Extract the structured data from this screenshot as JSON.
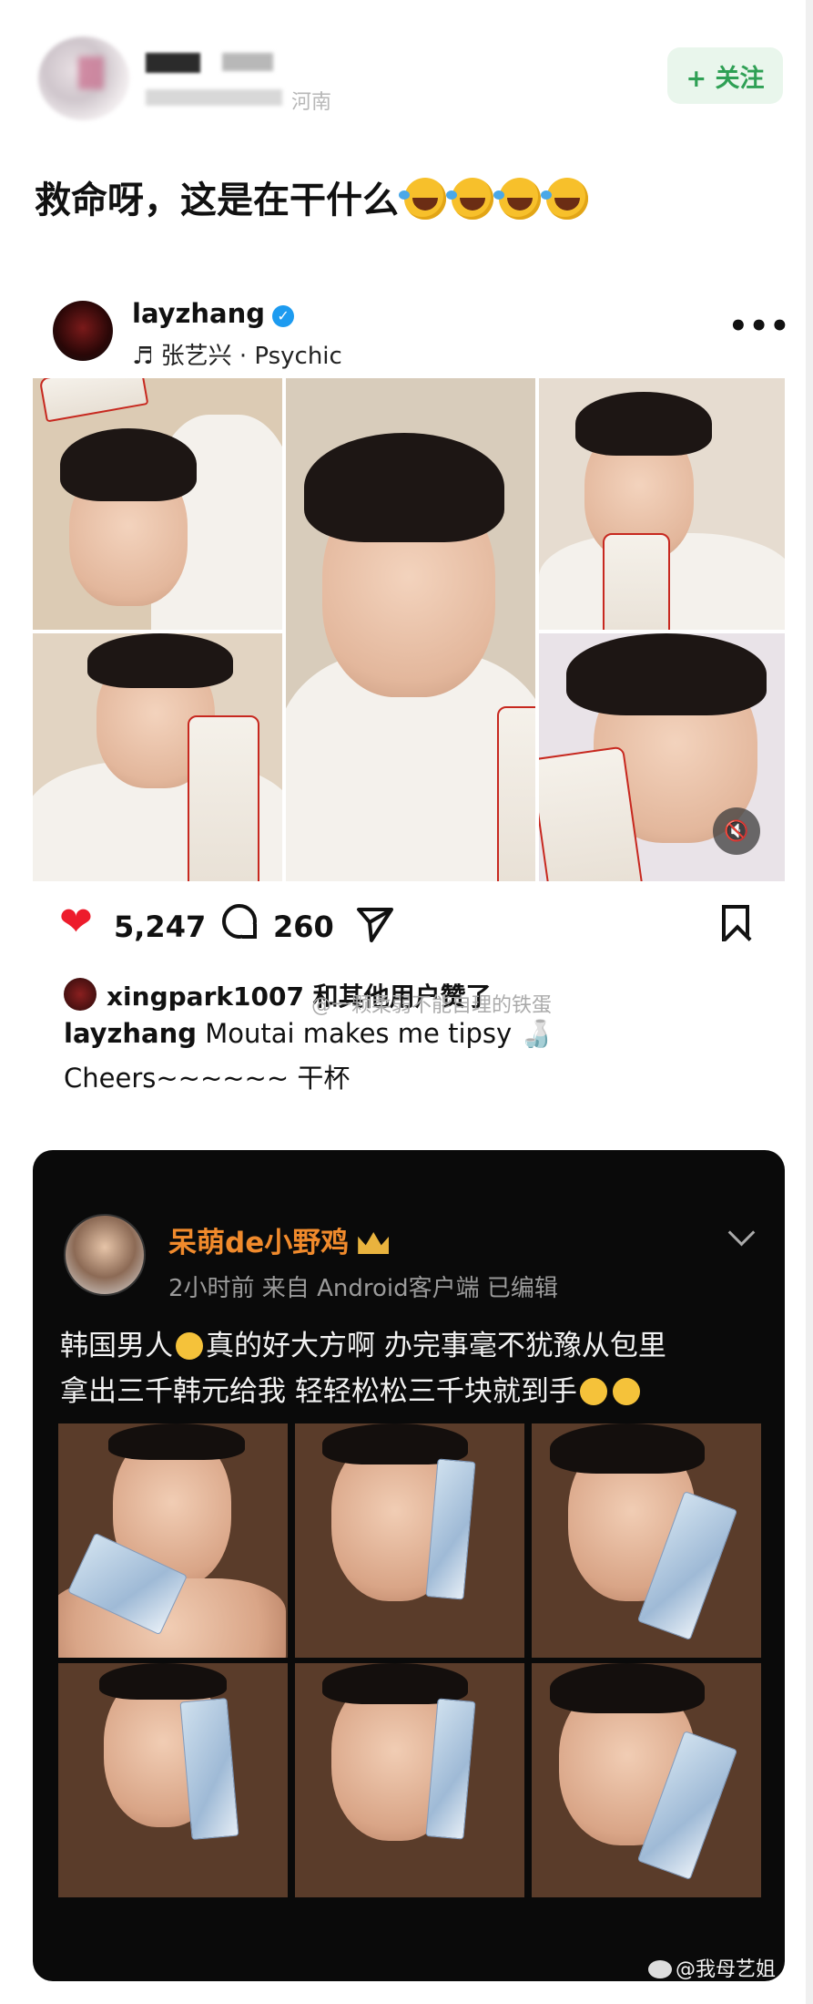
{
  "header": {
    "meta_text": "河南",
    "follow_label": "+ 关注"
  },
  "post": {
    "text": "救命呀，这是在干什么"
  },
  "instagram": {
    "username": "layzhang",
    "music": "♬ 张艺兴 · Psychic",
    "more": "•••",
    "likes": "5,247",
    "comments": "260",
    "liked_by": "xingpark1007 和其他用户赞了",
    "watermark": "@一颗柔弱不能自理的铁蛋",
    "caption_user": "layzhang",
    "caption_text": " Moutai makes me tipsy 🍶",
    "caption_line2": "Cheers~~~~~~ 干杯"
  },
  "weibo": {
    "name": "呆萌de小野鸡",
    "meta": "2小时前  来自 Android客户端  已编辑",
    "text_line1": "韩国男人",
    "text_line1b": "真的好大方啊 办完事毫不犹豫从包里",
    "text_line2": "拿出三千韩元给我 轻轻松松三千块就到手",
    "watermark": "@我母艺姐"
  },
  "colors": {
    "follow_green": "#2fa055",
    "like_red": "#ed1c2c",
    "weibo_orange": "#f08a2c",
    "verified_blue": "#1d9bf0"
  }
}
